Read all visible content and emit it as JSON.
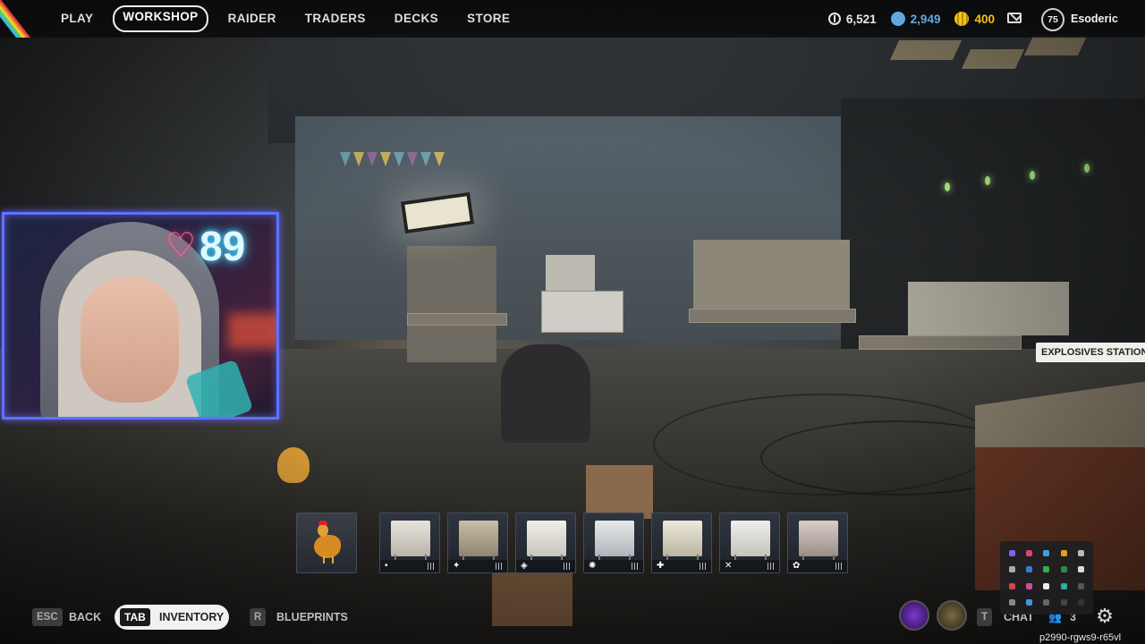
{
  "nav": {
    "items": [
      {
        "label": "PLAY",
        "active": false
      },
      {
        "label": "WORKSHOP",
        "active": true
      },
      {
        "label": "RAIDER",
        "active": false
      },
      {
        "label": "TRADERS",
        "active": false
      },
      {
        "label": "DECKS",
        "active": false
      },
      {
        "label": "STORE",
        "active": false
      }
    ]
  },
  "currencies": {
    "coins": {
      "value": "6,521",
      "icon": "coins-icon",
      "color": "#e6e6e6"
    },
    "credits": {
      "value": "2,949",
      "icon": "credits-icon",
      "color": "#5fa8e0"
    },
    "tokens": {
      "value": "400",
      "icon": "tokens-icon",
      "color": "#f0c419"
    }
  },
  "player": {
    "level": "75",
    "name": "Esoderic"
  },
  "stream_overlay": {
    "heart_rate": "89",
    "icon": "heart-icon",
    "accent": "#5a74ff"
  },
  "tooltip": {
    "text": "EXPLOSIVES STATION"
  },
  "hotbar": {
    "slots": [
      {
        "name": "rooster",
        "icon": "rooster-icon"
      },
      {
        "name": "workbench-1",
        "badge": "▪",
        "icon": "workbench-icon"
      },
      {
        "name": "workbench-2",
        "badge": "✦",
        "icon": "workbench-icon"
      },
      {
        "name": "workbench-3",
        "badge": "◈",
        "icon": "workbench-icon"
      },
      {
        "name": "workbench-4",
        "badge": "✺",
        "icon": "workbench-icon"
      },
      {
        "name": "workbench-5",
        "badge": "✚",
        "icon": "workbench-icon"
      },
      {
        "name": "workbench-6",
        "badge": "✕",
        "icon": "workbench-icon"
      },
      {
        "name": "workbench-7",
        "badge": "✿",
        "icon": "workbench-icon"
      }
    ]
  },
  "bottom": {
    "back": {
      "key": "ESC",
      "label": "BACK"
    },
    "inventory": {
      "key": "TAB",
      "label": "INVENTORY"
    },
    "blueprints": {
      "key": "R",
      "label": "BLUEPRINTS"
    },
    "chat": {
      "key": "T",
      "label": "CHAT"
    },
    "party_count": "3"
  },
  "session_id": "p2990-rgws9-r65vl"
}
